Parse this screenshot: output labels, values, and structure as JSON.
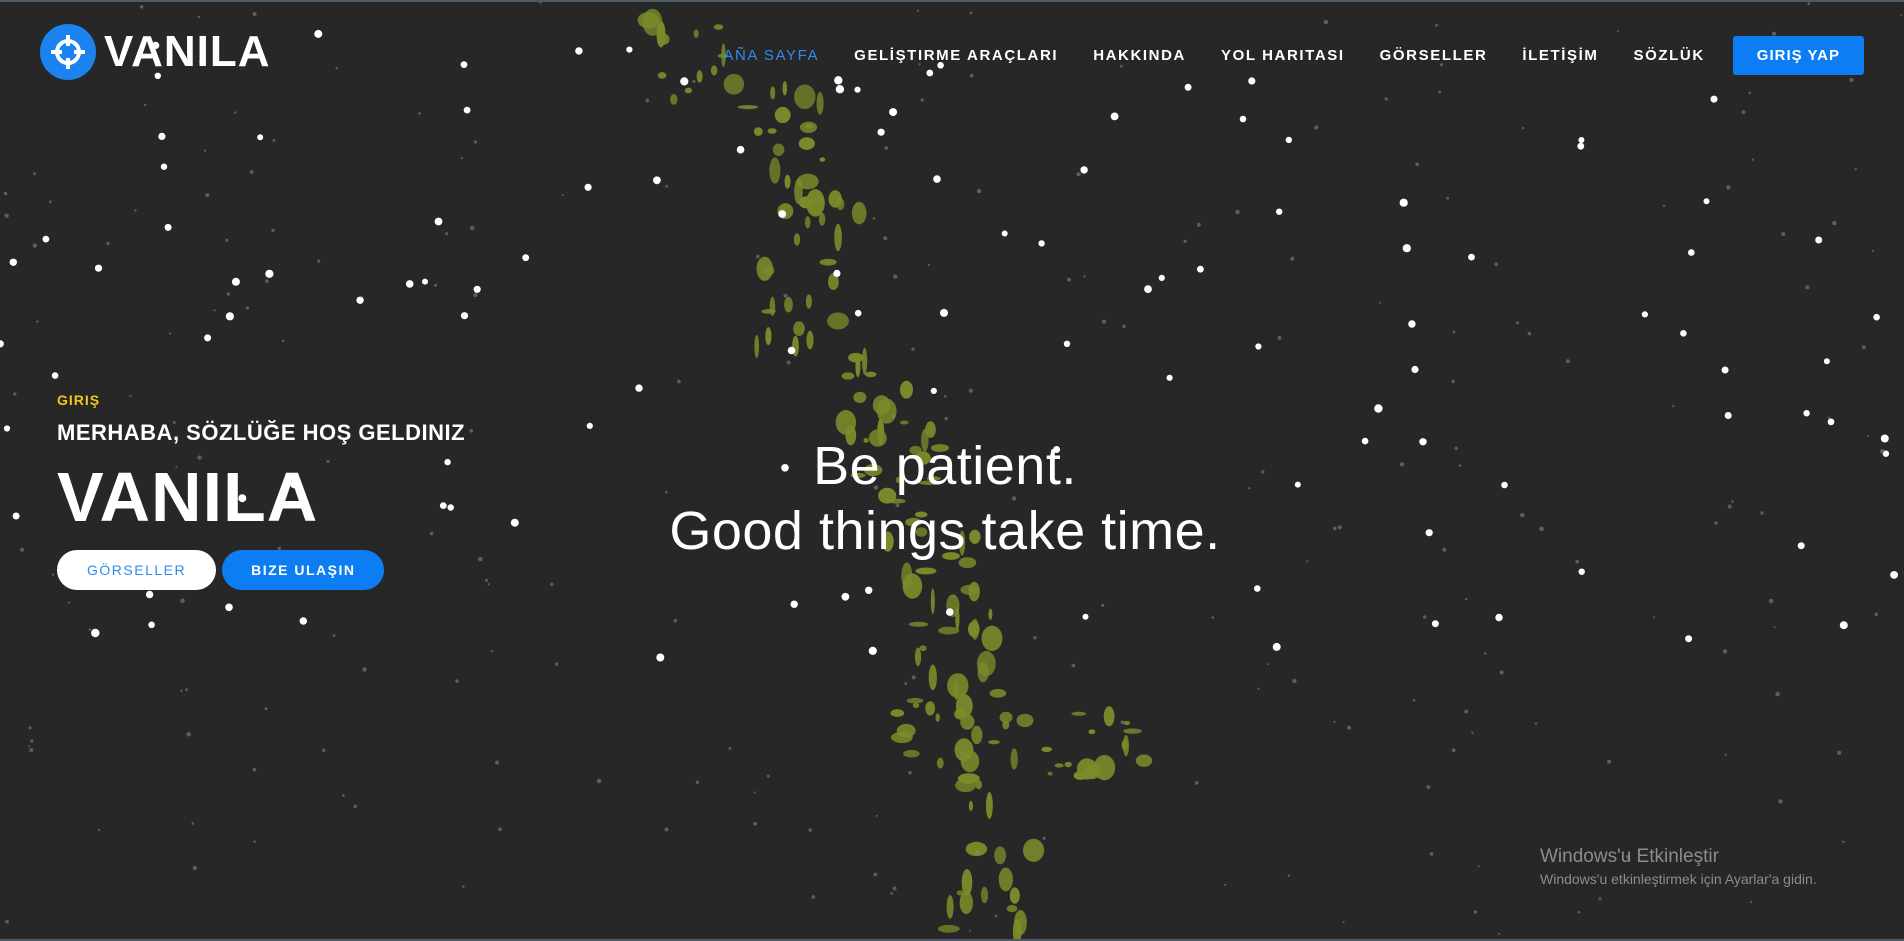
{
  "brand": {
    "name": "VANILA",
    "icon": "crosshair-icon",
    "accent_color": "#0c7df2"
  },
  "nav": {
    "items": [
      {
        "label": "AÑA SAYFA",
        "active": true
      },
      {
        "label": "GELİŞTIRME ARAÇLARI",
        "active": false
      },
      {
        "label": "HAKKINDA",
        "active": false
      },
      {
        "label": "YOL HARITASI",
        "active": false
      },
      {
        "label": "GÖRSELLER",
        "active": false
      },
      {
        "label": "İLETİŞİM",
        "active": false
      },
      {
        "label": "SÖZLÜK",
        "active": false
      }
    ],
    "login_label": "GIRIŞ YAP"
  },
  "hero": {
    "kicker": "GIRIŞ",
    "subtitle": "MERHABA, SÖZLÜĞE HOŞ GELDINIZ",
    "title": "VANILA",
    "primary_button": "GÖRSELLER",
    "secondary_button": "BIZE ULAŞIN"
  },
  "quote": {
    "line1": "Be patient.",
    "line2": "Good things take time."
  },
  "watermark": {
    "title": "Windows'u Etkinleştir",
    "subtitle": "Windows'u etkinleştirmek için Ayarlar'a gidin."
  },
  "colors": {
    "background": "#272727",
    "splatter": "#7a8c2a",
    "kicker": "#f5c518",
    "active_nav": "#2d8cf0"
  }
}
